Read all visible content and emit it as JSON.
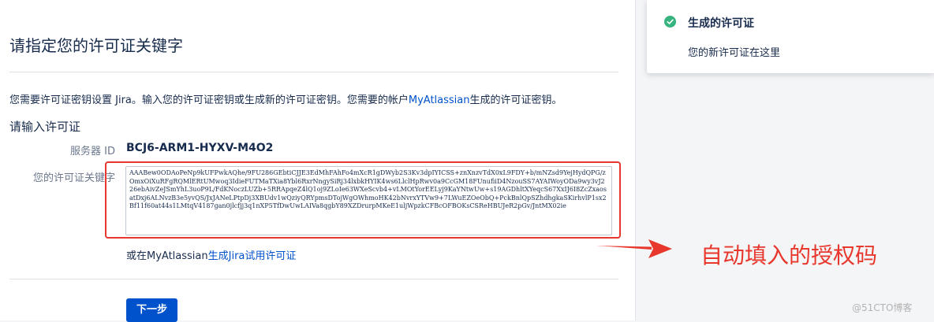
{
  "form": {
    "title": "请指定您的许可证关键字",
    "intro_prefix": "您需要许可证密钥设置 Jira。输入您的许可证密钥或生成新的许可证密钥。您需要的帐户",
    "intro_link": "MyAtlassian",
    "intro_suffix": "生成的许可证密钥。",
    "section_title": "请输入许可证",
    "server_id_label": "服务器 ID",
    "server_id_value": "BCJ6-ARM1-HYXV-M4O2",
    "license_key_label": "您的许可证关键字",
    "license_key_value": "AAABew0ODAoPeNp9kUFPwkAQhe/9FU286GEbtiCJJE3EdMhFAhFo4mXcR1gDWyb2S3Kv3dpIYICSS+znXnzvTdX0xL9FDY+b/mNZsd9YejHydQPG/zOmxOiXuRFgRQMlERtUMwoq3IdieFUTMaTXia8Ybl6RxrNngySiRj34lxbkHYIK4ws6LlclHpRwv0a9CcGM18FUnufiiD4NzouSS7AYAIWoyODa9wy3vJ226ebAivZeJSmYhL3uoP9L/FdKNoczLUZb+5RRApqeZ4lQ1oj9ZLoIe63WXeScvb4+vLMOtYorEELyj9KaYNtwUw+s19AGDhltXYeqcS67XxIJ6I8ZcZxaosatDxj6ALNvzB3e5yvQS/JxJANeLPtpDj3XBUdv1wQziyQRYpmsDTojWgOWhmoHK42bNvrxYTVw9+7LWuEZOeObQ+PckBnlQpSZhdhgkaSKirhvlP1sx2Bf11f60at44s1LMtqV4187gan0jlcfjj3q1nXP5TfDwUwLAIVa8qgbY89XZDrurpMKeE1uljWpzkCFBcOFBOKsCSReHBUJeR2pGv/JntMX02ie",
    "trial_prefix": "或在MyAtlassian",
    "trial_link": "生成Jira试用许可证",
    "next_label": "下一步"
  },
  "toast": {
    "title": "生成的许可证",
    "body": "您的新许可证在这里",
    "icon": "check-circle-icon",
    "icon_color": "#36b37e"
  },
  "annotation": {
    "text": "自动填入的授权码",
    "color": "#e8382e"
  },
  "watermark": "@51CTO博客",
  "colors": {
    "primary": "#0052cc",
    "link": "#0052cc",
    "highlight": "#e8382e"
  }
}
